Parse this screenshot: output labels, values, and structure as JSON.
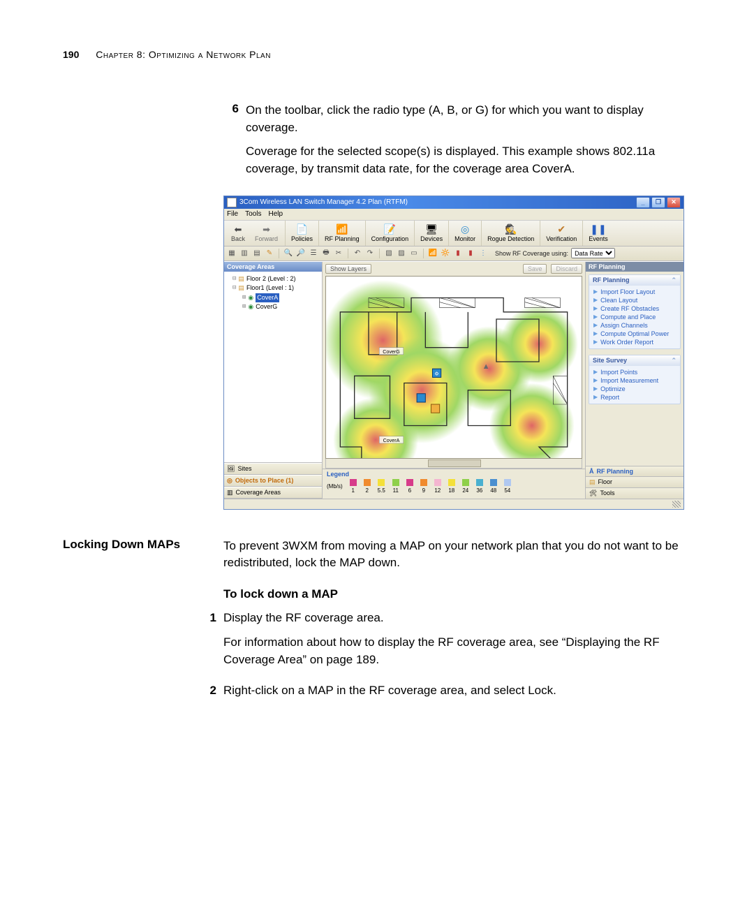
{
  "page": {
    "number": "190",
    "chapter": "Chapter 8: Optimizing a Network Plan"
  },
  "intro": {
    "step_num": "6",
    "step_text": "On the toolbar, click the radio type (A, B, or G) for which you want to display coverage.",
    "para": "Coverage for the selected scope(s) is displayed. This example shows 802.11a coverage, by transmit data rate, for the coverage area CoverA."
  },
  "locking": {
    "side_head": "Locking Down MAPs",
    "lead": "To prevent 3WXM from moving a MAP on your network plan that you do not want to be redistributed, lock the MAP down.",
    "subhead": "To lock down a MAP",
    "step1_num": "1",
    "step1_text": "Display the RF coverage area.",
    "step1_para": "For information about how to display the RF coverage area, see “Displaying the RF Coverage Area” on page 189.",
    "step2_num": "2",
    "step2_text": "Right-click on a MAP in the RF coverage area, and select Lock."
  },
  "app": {
    "title": "3Com Wireless LAN Switch Manager 4.2 Plan (RTFM)",
    "menus": [
      "File",
      "Tools",
      "Help"
    ],
    "nav_back": "Back",
    "nav_forward": "Forward",
    "toolbar": {
      "policies": "Policies",
      "rf_planning": "RF Planning",
      "configuration": "Configuration",
      "devices": "Devices",
      "monitor": "Monitor",
      "rogue": "Rogue Detection",
      "verification": "Verification",
      "events": "Events"
    },
    "subtoolbar": {
      "label": "Show RF Coverage using:",
      "dropdown": "Data Rate"
    },
    "left": {
      "header": "Coverage Areas",
      "tree": {
        "floor2": "Floor 2 (Level : 2)",
        "floor1": "Floor1 (Level : 1)",
        "coverA": "CoverA",
        "coverG": "CoverG"
      },
      "tabs": {
        "sites": "Sites",
        "objects": "Objects to Place (1)",
        "coverage": "Coverage Areas"
      }
    },
    "center": {
      "show_layers": "Show Layers",
      "save": "Save",
      "discard": "Discard",
      "label_coverA": "CoverA",
      "label_coverG": "CoverG",
      "legend_title": "Legend",
      "legend_unit": "(Mb/s)",
      "legend": [
        {
          "v": "1",
          "c": "#d73c8a"
        },
        {
          "v": "2",
          "c": "#f08b2e"
        },
        {
          "v": "5.5",
          "c": "#f4e03a"
        },
        {
          "v": "11",
          "c": "#8fd04a"
        },
        {
          "v": "6",
          "c": "#d73c8a"
        },
        {
          "v": "9",
          "c": "#f08b2e"
        },
        {
          "v": "12",
          "c": "#f4b5d0"
        },
        {
          "v": "18",
          "c": "#f4e03a"
        },
        {
          "v": "24",
          "c": "#8fd04a"
        },
        {
          "v": "36",
          "c": "#4ab0d0"
        },
        {
          "v": "48",
          "c": "#4a8fd0"
        },
        {
          "v": "54",
          "c": "#b0c8f0"
        }
      ]
    },
    "right": {
      "header": "RF Planning",
      "group1": {
        "title": "RF Planning",
        "items": [
          "Import Floor Layout",
          "Clean Layout",
          "Create RF Obstacles",
          "Compute and Place",
          "Assign Channels",
          "Compute Optimal Power",
          "Work Order Report"
        ]
      },
      "group2": {
        "title": "Site Survey",
        "items": [
          "Import Points",
          "Import Measurement",
          "Optimize",
          "Report"
        ]
      },
      "tabs": {
        "rf": "RF Planning",
        "floor": "Floor",
        "tools": "Tools"
      }
    }
  }
}
